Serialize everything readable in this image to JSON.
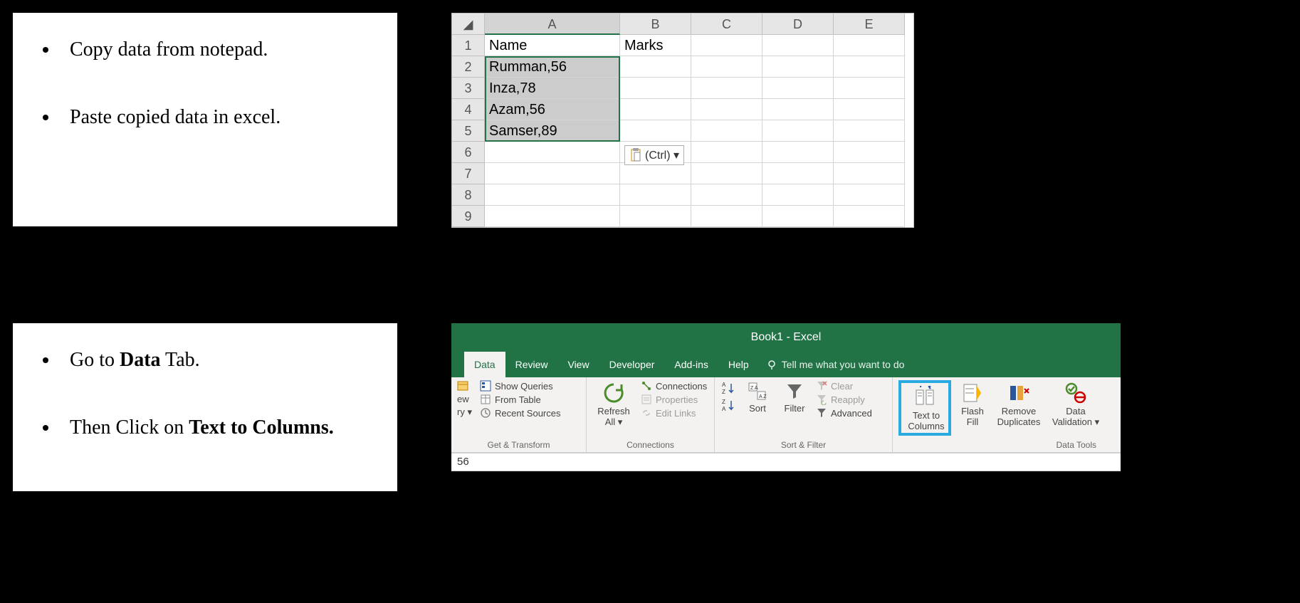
{
  "instructions": {
    "top": {
      "item1": "Copy data from notepad.",
      "item2": "Paste copied data in excel."
    },
    "bottom": {
      "item1_pre": "Go to ",
      "item1_bold": "Data",
      "item1_post": " Tab.",
      "item2_pre": "Then Click on ",
      "item2_bold": "Text to Columns."
    }
  },
  "sheet": {
    "columns": [
      "A",
      "B",
      "C",
      "D",
      "E"
    ],
    "rows": [
      "1",
      "2",
      "3",
      "4",
      "5",
      "6",
      "7",
      "8",
      "9"
    ],
    "cells": {
      "A1": "Name",
      "B1": "Marks",
      "A2": "Rumman,56",
      "A3": "Inza,78",
      "A4": "Azam,56",
      "A5": "Samser,89"
    },
    "paste_options": "(Ctrl) ▾"
  },
  "ribbon": {
    "title": "Book1  -  Excel",
    "tabs": [
      "Data",
      "Review",
      "View",
      "Developer",
      "Add-ins",
      "Help"
    ],
    "tellme": "Tell me what you want to do",
    "groups": {
      "get_transform": {
        "label": "Get & Transform",
        "ew": "ew",
        "ry": "ry ▾",
        "show_queries": "Show Queries",
        "from_table": "From Table",
        "recent_sources": "Recent Sources"
      },
      "connections": {
        "label": "Connections",
        "refresh": "Refresh All ▾",
        "connections": "Connections",
        "properties": "Properties",
        "edit_links": "Edit Links"
      },
      "sort_filter": {
        "label": "Sort & Filter",
        "sort": "Sort",
        "filter": "Filter",
        "clear": "Clear",
        "reapply": "Reapply",
        "advanced": "Advanced"
      },
      "data_tools": {
        "label": "Data Tools",
        "text_to_columns": "Text to Columns",
        "flash_fill": "Flash Fill",
        "remove_duplicates": "Remove Duplicates",
        "data_validation": "Data Validation ▾"
      }
    },
    "formula_bar": "56"
  }
}
